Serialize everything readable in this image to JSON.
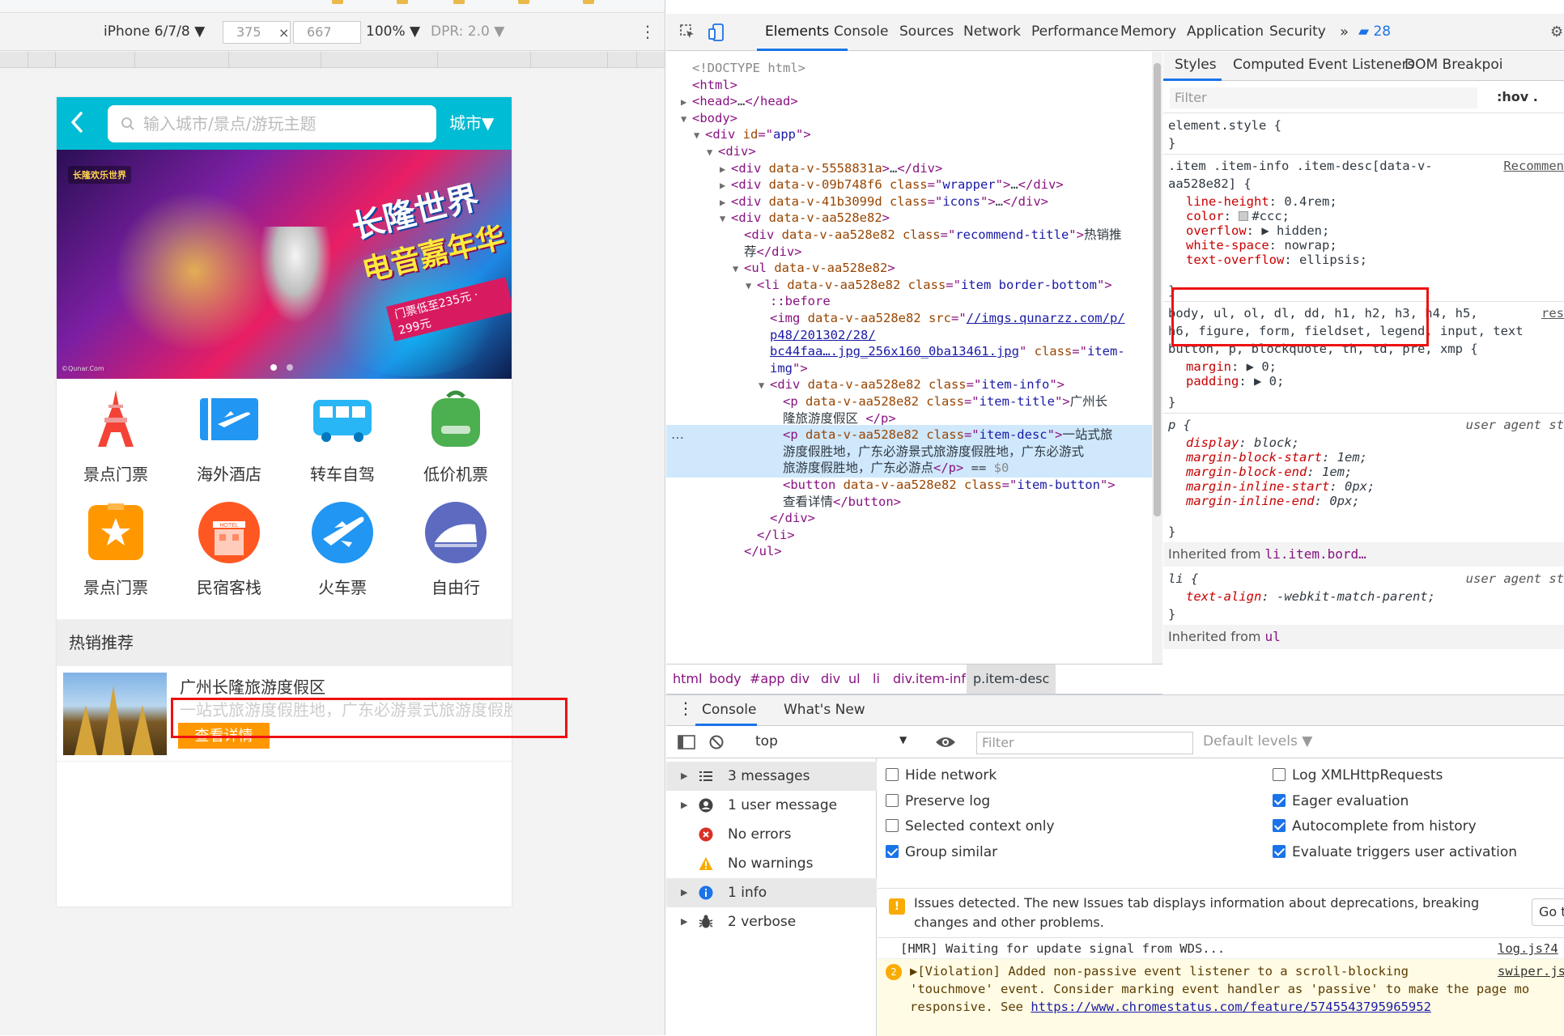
{
  "emulator": {
    "device": "iPhone 6/7/8 ▼",
    "width": "375",
    "times": "×",
    "height": "667",
    "zoom": "100% ▼",
    "dpr": "DPR: 2.0 ▼",
    "more": "⋮"
  },
  "phone": {
    "search_placeholder": "输入城市/景点/游玩主题",
    "city": "城市▼",
    "banner": {
      "logo_text": "长隆欢乐世界",
      "title_line1": "长隆世界",
      "title_line2": "电音嘉年华",
      "price_text": "门票低至235元 · 299元",
      "source": "©Qunar.Com"
    },
    "icons": [
      {
        "label": "景点门票",
        "icon": "eiffel-tower-icon",
        "color": "#f44336"
      },
      {
        "label": "海外酒店",
        "icon": "plane-ticket-icon",
        "color": "#2196f3"
      },
      {
        "label": "转车自驾",
        "icon": "bus-icon",
        "color": "#29b6f6"
      },
      {
        "label": "低价机票",
        "icon": "backpack-icon",
        "color": "#4caf50"
      },
      {
        "label": "景点门票",
        "icon": "star-ticket-icon",
        "color": "#ff9800"
      },
      {
        "label": "民宿客栈",
        "icon": "hotel-icon",
        "color": "#ff5722"
      },
      {
        "label": "火车票",
        "icon": "airplane-circle-icon",
        "color": "#2196f3"
      },
      {
        "label": "自由行",
        "icon": "train-circle-icon",
        "color": "#5c6bc0"
      }
    ],
    "section_title": "热销推荐",
    "item": {
      "title": "广州长隆旅游度假区",
      "desc": "一站式旅游度假胜地，广东必游景式旅游度假胜地，广东必游景式旅游度假胜地，广东必游点",
      "button": "查看详情"
    }
  },
  "devtools": {
    "tabs": [
      "Elements",
      "Console",
      "Sources",
      "Network",
      "Performance",
      "Memory",
      "Application",
      "Security"
    ],
    "more": "»",
    "issues_count": "28",
    "dom": [
      {
        "indent": 0,
        "tri": "",
        "parts": [
          [
            "gr",
            "<!DOCTYPE html>"
          ]
        ]
      },
      {
        "indent": 0,
        "tri": "",
        "parts": [
          [
            "tg",
            "<html>"
          ]
        ]
      },
      {
        "indent": 0,
        "tri": "▶",
        "parts": [
          [
            "tg",
            "<head>"
          ],
          [
            "tx",
            "…"
          ],
          [
            "tg",
            "</head>"
          ]
        ]
      },
      {
        "indent": 0,
        "tri": "▼",
        "parts": [
          [
            "tg",
            "<body>"
          ]
        ]
      },
      {
        "indent": 1,
        "tri": "▼",
        "parts": [
          [
            "tg",
            "<div "
          ],
          [
            "an",
            "id"
          ],
          [
            "tg",
            "=\""
          ],
          [
            "av",
            "app"
          ],
          [
            "tg",
            "\">"
          ]
        ]
      },
      {
        "indent": 2,
        "tri": "▼",
        "parts": [
          [
            "tg",
            "<div>"
          ]
        ]
      },
      {
        "indent": 3,
        "tri": "▶",
        "parts": [
          [
            "tg",
            "<div "
          ],
          [
            "an",
            "data-v-5558831a"
          ],
          [
            "tg",
            ">"
          ],
          [
            "tx",
            "…"
          ],
          [
            "tg",
            "</div>"
          ]
        ]
      },
      {
        "indent": 3,
        "tri": "▶",
        "parts": [
          [
            "tg",
            "<div "
          ],
          [
            "an",
            "data-v-09b748f6 class"
          ],
          [
            "tg",
            "=\""
          ],
          [
            "av",
            "wrapper"
          ],
          [
            "tg",
            "\">"
          ],
          [
            "tx",
            "…"
          ],
          [
            "tg",
            "</div>"
          ]
        ]
      },
      {
        "indent": 3,
        "tri": "▶",
        "parts": [
          [
            "tg",
            "<div "
          ],
          [
            "an",
            "data-v-41b3099d class"
          ],
          [
            "tg",
            "=\""
          ],
          [
            "av",
            "icons"
          ],
          [
            "tg",
            "\">"
          ],
          [
            "tx",
            "…"
          ],
          [
            "tg",
            "</div>"
          ]
        ]
      },
      {
        "indent": 3,
        "tri": "▼",
        "parts": [
          [
            "tg",
            "<div "
          ],
          [
            "an",
            "data-v-aa528e82"
          ],
          [
            "tg",
            ">"
          ]
        ]
      },
      {
        "indent": 4,
        "tri": "",
        "parts": [
          [
            "tg",
            "<div "
          ],
          [
            "an",
            "data-v-aa528e82 class"
          ],
          [
            "tg",
            "=\""
          ],
          [
            "av",
            "recommend-title"
          ],
          [
            "tg",
            "\">"
          ],
          [
            "tx",
            "热销推"
          ]
        ]
      },
      {
        "indent": 4,
        "tri": "",
        "parts": [
          [
            "tx",
            "荐"
          ],
          [
            "tg",
            "</div>"
          ]
        ]
      },
      {
        "indent": 4,
        "tri": "▼",
        "parts": [
          [
            "tg",
            "<ul "
          ],
          [
            "an",
            "data-v-aa528e82"
          ],
          [
            "tg",
            ">"
          ]
        ]
      },
      {
        "indent": 5,
        "tri": "▼",
        "parts": [
          [
            "tg",
            "<li "
          ],
          [
            "an",
            "data-v-aa528e82 class"
          ],
          [
            "tg",
            "=\""
          ],
          [
            "av",
            "item border-bottom"
          ],
          [
            "tg",
            "\">"
          ]
        ]
      },
      {
        "indent": 6,
        "tri": "",
        "parts": [
          [
            "tg",
            "::before"
          ]
        ]
      },
      {
        "indent": 6,
        "tri": "",
        "parts": [
          [
            "tg",
            "<img "
          ],
          [
            "an",
            "data-v-aa528e82 src"
          ],
          [
            "tg",
            "=\""
          ],
          [
            "ln",
            "//imgs.qunarzz.com/p/"
          ]
        ]
      },
      {
        "indent": 6,
        "tri": "",
        "parts": [
          [
            "ln",
            "p48/201302/28/"
          ]
        ]
      },
      {
        "indent": 6,
        "tri": "",
        "parts": [
          [
            "ln",
            "bc44faa….jpg_256x160_0ba13461.jpg"
          ],
          [
            "tg",
            "\" "
          ],
          [
            "an",
            "class"
          ],
          [
            "tg",
            "=\""
          ],
          [
            "av",
            "item-"
          ]
        ]
      },
      {
        "indent": 6,
        "tri": "",
        "parts": [
          [
            "av",
            "img"
          ],
          [
            "tg",
            "\">"
          ]
        ]
      },
      {
        "indent": 6,
        "tri": "▼",
        "parts": [
          [
            "tg",
            "<div "
          ],
          [
            "an",
            "data-v-aa528e82 class"
          ],
          [
            "tg",
            "=\""
          ],
          [
            "av",
            "item-info"
          ],
          [
            "tg",
            "\">"
          ]
        ]
      },
      {
        "indent": 7,
        "tri": "",
        "parts": [
          [
            "tg",
            "<p "
          ],
          [
            "an",
            "data-v-aa528e82 class"
          ],
          [
            "tg",
            "=\""
          ],
          [
            "av",
            "item-title"
          ],
          [
            "tg",
            "\">"
          ],
          [
            "tx",
            "广州长"
          ]
        ]
      },
      {
        "indent": 7,
        "tri": "",
        "parts": [
          [
            "tx",
            "隆旅游度假区 "
          ],
          [
            "tg",
            "</p>"
          ]
        ]
      },
      {
        "indent": 7,
        "tri": "",
        "sel": true,
        "parts": [
          [
            "tg",
            "<p "
          ],
          [
            "an",
            "data-v-aa528e82 class"
          ],
          [
            "tg",
            "=\""
          ],
          [
            "av",
            "item-desc"
          ],
          [
            "tg",
            "\">"
          ],
          [
            "tx",
            "一站式旅"
          ]
        ]
      },
      {
        "indent": 7,
        "tri": "",
        "sel": true,
        "parts": [
          [
            "tx",
            "游度假胜地，广东必游景式旅游度假胜地，广东必游式"
          ]
        ]
      },
      {
        "indent": 7,
        "tri": "",
        "sel": true,
        "parts": [
          [
            "tx",
            "旅游度假胜地，广东必游点"
          ],
          [
            "tg",
            "</p>"
          ],
          [
            "tx",
            " == "
          ],
          [
            "gr",
            "$0"
          ]
        ]
      },
      {
        "indent": 7,
        "tri": "",
        "parts": [
          [
            "tg",
            "<button "
          ],
          [
            "an",
            "data-v-aa528e82 class"
          ],
          [
            "tg",
            "=\""
          ],
          [
            "av",
            "item-button"
          ],
          [
            "tg",
            "\">"
          ]
        ]
      },
      {
        "indent": 7,
        "tri": "",
        "parts": [
          [
            "tx",
            "查看详情"
          ],
          [
            "tg",
            "</button>"
          ]
        ]
      },
      {
        "indent": 6,
        "tri": "",
        "parts": [
          [
            "tg",
            "</div>"
          ]
        ]
      },
      {
        "indent": 5,
        "tri": "",
        "parts": [
          [
            "tg",
            "</li>"
          ]
        ]
      },
      {
        "indent": 4,
        "tri": "",
        "parts": [
          [
            "tg",
            "</ul>"
          ]
        ]
      }
    ],
    "dom_dots": "…",
    "crumbs": [
      "html",
      "body",
      "#app",
      "div",
      "div",
      "ul",
      "li",
      "div.item-info",
      "p.item-desc"
    ],
    "styles": {
      "tabs": [
        "Styles",
        "Computed",
        "Event Listeners",
        "DOM Breakpoi"
      ],
      "filter_placeholder": "Filter",
      "hov": ":hov  .",
      "element_style": "element.style {",
      "close": "}",
      "rule1_sel1": ".item .item-info .item-desc[data-v-",
      "rule1_link": "Recommen",
      "rule1_sel2": "aa528e82] {",
      "rule1_props": [
        {
          "name": "line-height",
          "val": "0.4rem;"
        },
        {
          "name": "color",
          "val": "#ccc;",
          "swatch": true
        },
        {
          "name": "overflow",
          "val": "▶ hidden;"
        },
        {
          "name": "white-space",
          "val": "nowrap;"
        },
        {
          "name": "text-overflow",
          "val": "ellipsis;"
        }
      ],
      "rule2_sel1": "body, ul, ol, dl, dd, h1, h2, h3, h4, h5,",
      "rule2_link": "res",
      "rule2_sel2": "h6, figure, form, fieldset, legend, input, text",
      "rule2_sel3": "button, p, blockquote, th, td, pre, xmp {",
      "rule2_props": [
        {
          "name": "margin",
          "val": "▶ 0;"
        },
        {
          "name": "padding",
          "val": "▶ 0;"
        }
      ],
      "rule3_sel": "p {",
      "ua": "user agent st",
      "rule3_props": [
        {
          "name": "display",
          "val": "block;"
        },
        {
          "name": "margin-block-start",
          "val": "1em;"
        },
        {
          "name": "margin-block-end",
          "val": "1em;"
        },
        {
          "name": "margin-inline-start",
          "val": "0px;"
        },
        {
          "name": "margin-inline-end",
          "val": "0px;"
        }
      ],
      "inherited1_pre": "Inherited from ",
      "inherited1_el": "li.item.bord…",
      "rule4_sel": "li {",
      "rule4_props": [
        {
          "name": "text-align",
          "val": "-webkit-match-parent;"
        }
      ],
      "inherited2_pre": "Inherited from ",
      "inherited2_el": "ul"
    },
    "drawer": {
      "tabs": [
        "Console",
        "What's New"
      ],
      "context": "top",
      "filter_placeholder": "Filter",
      "levels": "Default levels ▼",
      "sidebar": [
        {
          "label": "3 messages",
          "icon": "list-icon"
        },
        {
          "label": "1 user message",
          "icon": "user-icon"
        },
        {
          "label": "No errors",
          "icon": "error-icon"
        },
        {
          "label": "No warnings",
          "icon": "warning-icon"
        },
        {
          "label": "1 info",
          "icon": "info-icon"
        },
        {
          "label": "2 verbose",
          "icon": "bug-icon"
        }
      ],
      "settings_left": [
        {
          "label": "Hide network",
          "checked": false
        },
        {
          "label": "Preserve log",
          "checked": false
        },
        {
          "label": "Selected context only",
          "checked": false
        },
        {
          "label": "Group similar",
          "checked": true
        }
      ],
      "settings_right": [
        {
          "label": "Log XMLHttpRequests",
          "checked": false
        },
        {
          "label": "Eager evaluation",
          "checked": true
        },
        {
          "label": "Autocomplete from history",
          "checked": true
        },
        {
          "label": "Evaluate triggers user activation",
          "checked": true
        }
      ],
      "issue_text": "Issues detected. The new Issues tab displays information about deprecations, breaking changes and other problems.",
      "issue_button": "Go t",
      "log1": "[HMR] Waiting for update signal from WDS...",
      "log1_src": "log.js?4",
      "log2_count": "2",
      "log2_line1": "▶[Violation] Added non-passive event listener to a scroll-blocking",
      "log2_src": "swiper.js?82c",
      "log2_line2": "'touchmove' event. Consider marking event handler as 'passive' to make the page mo",
      "log2_line3": "responsive. See ",
      "log2_link": "https://www.chromestatus.com/feature/5745543795965952"
    }
  }
}
